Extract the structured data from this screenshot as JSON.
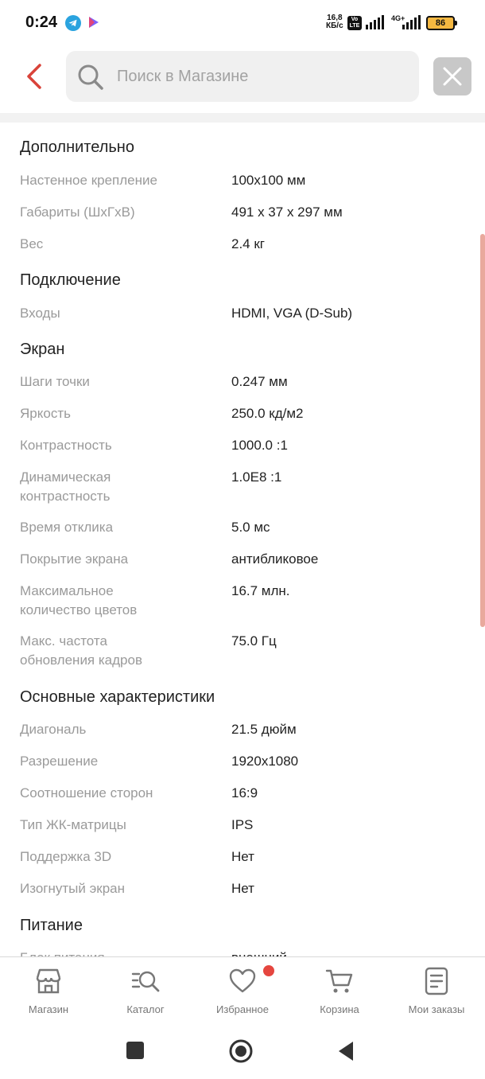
{
  "status_bar": {
    "time": "0:24",
    "speed_value": "16,8",
    "speed_unit": "КБ/с",
    "volte_top": "Vo",
    "volte_bottom": "LTE",
    "network": "4G+",
    "battery": "86"
  },
  "search": {
    "placeholder": "Поиск в Магазине"
  },
  "sections": [
    {
      "title": "Дополнительно",
      "rows": [
        {
          "label": "Настенное крепление",
          "value": "100x100 мм"
        },
        {
          "label": "Габариты (ШxГxВ)",
          "value": "491 x 37 x 297 мм"
        },
        {
          "label": "Вес",
          "value": "2.4 кг"
        }
      ]
    },
    {
      "title": "Подключение",
      "rows": [
        {
          "label": "Входы",
          "value": "HDMI, VGA (D-Sub)"
        }
      ]
    },
    {
      "title": "Экран",
      "rows": [
        {
          "label": "Шаги точки",
          "value": "0.247 мм"
        },
        {
          "label": "Яркость",
          "value": "250.0 кд/м2"
        },
        {
          "label": "Контрастность",
          "value": "1000.0 :1"
        },
        {
          "label": "Динамическая контрастность",
          "value": "1.0E8 :1"
        },
        {
          "label": "Время отклика",
          "value": "5.0 мс"
        },
        {
          "label": "Покрытие экрана",
          "value": "антибликовое"
        },
        {
          "label": "Максимальное количество цветов",
          "value": "16.7 млн."
        },
        {
          "label": "Макс. частота обновления кадров",
          "value": "75.0 Гц"
        }
      ]
    },
    {
      "title": "Основные характеристики",
      "rows": [
        {
          "label": "Диагональ",
          "value": "21.5 дюйм"
        },
        {
          "label": "Разрешение",
          "value": "1920x1080"
        },
        {
          "label": "Соотношение сторон",
          "value": "16:9"
        },
        {
          "label": "Тип ЖК-матрицы",
          "value": "IPS"
        },
        {
          "label": "Поддержка 3D",
          "value": "Нет"
        },
        {
          "label": "Изогнутый экран",
          "value": "Нет"
        }
      ]
    },
    {
      "title": "Питание",
      "rows": [
        {
          "label": "Блок питания",
          "value": "внешний"
        }
      ]
    }
  ],
  "bottom_nav": {
    "items": [
      {
        "label": "Магазин",
        "icon": "store-icon"
      },
      {
        "label": "Каталог",
        "icon": "catalog-search-icon"
      },
      {
        "label": "Избранное",
        "icon": "heart-icon"
      },
      {
        "label": "Корзина",
        "icon": "cart-icon"
      },
      {
        "label": "Мои заказы",
        "icon": "orders-icon"
      }
    ]
  },
  "colors": {
    "accent": "#d9433a",
    "scrollbar": "#e9a99d",
    "label_gray": "#9a9a9a",
    "badge": "#e5463f"
  }
}
